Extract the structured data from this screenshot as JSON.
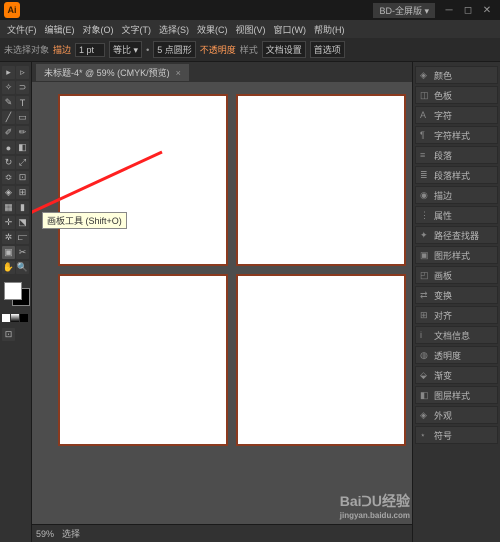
{
  "titlebar": {
    "logo": "Ai",
    "workspace": "BD-全屏版 ▾"
  },
  "menubar": [
    "文件(F)",
    "编辑(E)",
    "对象(O)",
    "文字(T)",
    "选择(S)",
    "效果(C)",
    "视图(V)",
    "窗口(W)",
    "帮助(H)"
  ],
  "controlbar": {
    "noselect": "未选择对象",
    "stroke_label": "描边",
    "stroke_val": "1 pt",
    "uniform": "等比 ▾",
    "style_label": "5 点圆形",
    "opacity_label": "不透明度",
    "styles": "样式",
    "docsetup": "文档设置",
    "prefs": "首选项"
  },
  "tab": {
    "title": "未标题-4* @ 59% (CMYK/预览)"
  },
  "tooltip": "画板工具 (Shift+O)",
  "statusbar": {
    "zoom": "59%",
    "status": "选择"
  },
  "panels": [
    {
      "icon": "◈",
      "label": "颜色"
    },
    {
      "icon": "◫",
      "label": "色板"
    },
    {
      "icon": "A",
      "label": "字符"
    },
    {
      "icon": "¶",
      "label": "字符样式"
    },
    {
      "icon": "≡",
      "label": "段落"
    },
    {
      "icon": "≣",
      "label": "段落样式"
    },
    {
      "icon": "◉",
      "label": "描边"
    },
    {
      "icon": "⋮",
      "label": "属性"
    },
    {
      "icon": "✦",
      "label": "路径查找器"
    },
    {
      "icon": "▣",
      "label": "图形样式"
    },
    {
      "icon": "◰",
      "label": "画板"
    },
    {
      "icon": "⇄",
      "label": "变换"
    },
    {
      "icon": "⊞",
      "label": "对齐"
    },
    {
      "icon": "i",
      "label": "文档信息"
    },
    {
      "icon": "◍",
      "label": "透明度"
    },
    {
      "icon": "⬙",
      "label": "渐变"
    },
    {
      "icon": "◧",
      "label": "图层样式"
    },
    {
      "icon": "◈",
      "label": "外观"
    },
    {
      "icon": "⋆",
      "label": "符号"
    }
  ],
  "watermark": {
    "main": "Baiᑐᑌ经验",
    "sub": "jingyan.baidu.com"
  }
}
